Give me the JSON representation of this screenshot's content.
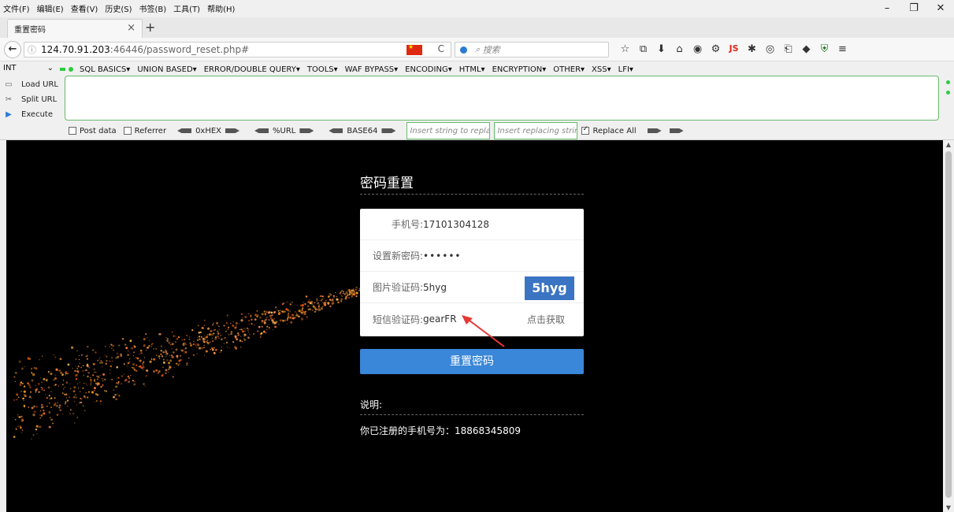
{
  "menu": [
    "文件(F)",
    "编辑(E)",
    "查看(V)",
    "历史(S)",
    "书签(B)",
    "工具(T)",
    "帮助(H)"
  ],
  "window_controls": [
    "–",
    "❐",
    "✕"
  ],
  "tab": {
    "title": "重置密码",
    "close": "×",
    "new": "+"
  },
  "nav": {
    "back": "←",
    "info": "ⓘ",
    "url_host": "124.70.91.203",
    "url_path": ":46446/password_reset.php#",
    "reload": "C",
    "search_placeholder": "搜索"
  },
  "toolbar_icons": [
    "☆",
    "⧉",
    "⬇",
    "⌂",
    "◉",
    "⚙",
    "JS",
    "✱",
    "◎",
    "⎗",
    "◆",
    "⛨"
  ],
  "hackbar": {
    "select_value": "INT",
    "menu_items": [
      "SQL BASICS▾",
      "UNION BASED▾",
      "ERROR/DOUBLE QUERY▾",
      "TOOLS▾",
      "WAF BYPASS▾",
      "ENCODING▾",
      "HTML▾",
      "ENCRYPTION▾",
      "OTHER▾",
      "XSS▾",
      "LFI▾"
    ],
    "load_url": "Load URL",
    "split_url": "Split URL",
    "execute": "Execute",
    "post_data": "Post data",
    "referrer": "Referrer",
    "hex": "0xHEX",
    "url_enc": "%URL",
    "base64": "BASE64",
    "replace_placeholder": "Insert string to replace",
    "replacing_placeholder": "Insert replacing string",
    "replace_all": "Replace All"
  },
  "form": {
    "title": "密码重置",
    "phone_label": "手机号:",
    "phone_value": "17101304128",
    "password_label": "设置新密码:",
    "password_value": "••••••",
    "captcha_label": "图片验证码:",
    "captcha_value": "5hyg",
    "captcha_image_text": "5hyg",
    "sms_label": "短信验证码:",
    "sms_value": "gearFR",
    "get_code": "点击获取",
    "submit": "重置密码"
  },
  "note": {
    "label": "说明:",
    "text": "你已注册的手机号为：18868345809"
  },
  "colors": {
    "submit": "#3a86d8",
    "captcha_bg": "#3a74c2",
    "arrow": "#e53935",
    "page_bg": "#000000"
  }
}
